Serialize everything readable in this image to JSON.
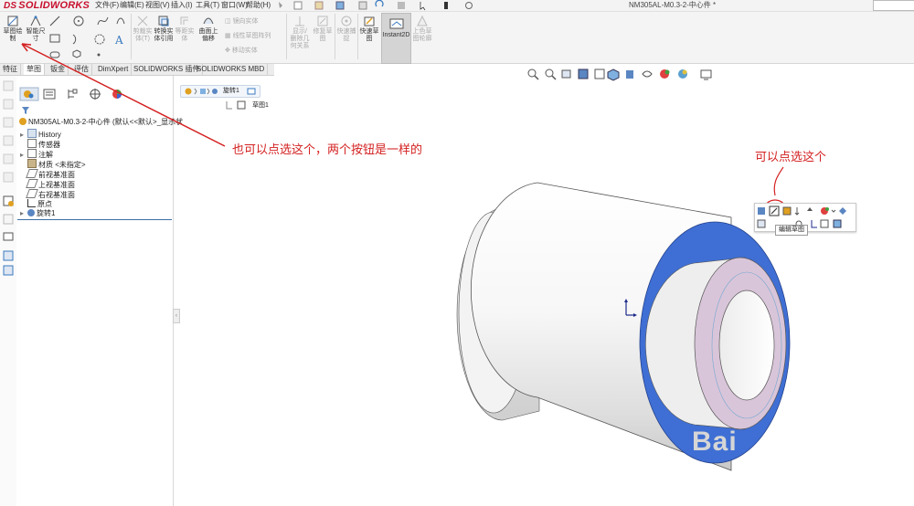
{
  "app": {
    "logo_ds": "DS",
    "logo_text": "SOLIDWORKS",
    "document_title": "NM305AL-M0.3-2-中心件 *",
    "search_placeholder": ""
  },
  "menu": [
    "文件(F)",
    "编辑(E)",
    "视图(V)",
    "插入(I)",
    "工具(T)",
    "窗口(W)",
    "帮助(H)"
  ],
  "ribbon": {
    "sketch_label_1": "草图绘",
    "sketch_label_2": "制",
    "smart_dim_1": "智能尺",
    "smart_dim_2": "寸",
    "trim_1": "剪裁实",
    "trim_2": "体(T)",
    "convert_1": "转换实",
    "convert_2": "体引用",
    "offset_1": "等距实",
    "offset_2": "体",
    "surface_offset_1": "曲面上",
    "surface_offset_2": "偏移",
    "mirror": "镜向实体",
    "linear_pattern": "线性草图阵列",
    "move": "移动实体",
    "display_delete_1": "显示/",
    "display_delete_2": "删除几",
    "display_delete_3": "何关系",
    "repair_1": "修复草",
    "repair_2": "图",
    "quick_snap_1": "快速捕",
    "quick_snap_2": "捉",
    "rapid_sketch_1": "快速草",
    "rapid_sketch_2": "图",
    "instant2d": "Instant2D",
    "shaded_1": "上色草",
    "shaded_2": "图轮廓"
  },
  "tabs": [
    {
      "label": "特征",
      "active": false
    },
    {
      "label": "草图",
      "active": true
    },
    {
      "label": "钣金",
      "active": false
    },
    {
      "label": "评估",
      "active": false
    },
    {
      "label": "DimXpert",
      "active": false
    },
    {
      "label": "SOLIDWORKS 插件",
      "active": false
    },
    {
      "label": "SOLIDWORKS MBD",
      "active": false
    }
  ],
  "tree": {
    "root": "NM305AL-M0.3-2-中心件 (默认<<默认>_显示状",
    "items": [
      {
        "label": "History",
        "expander": "▸"
      },
      {
        "label": "传感器",
        "expander": ""
      },
      {
        "label": "注解",
        "expander": "▸"
      },
      {
        "label": "材质 <未指定>",
        "expander": ""
      },
      {
        "label": "前视基准面",
        "expander": ""
      },
      {
        "label": "上视基准面",
        "expander": ""
      },
      {
        "label": "右视基准面",
        "expander": ""
      },
      {
        "label": "原点",
        "expander": ""
      },
      {
        "label": "旋转1",
        "expander": "▸"
      }
    ]
  },
  "breadcrumb": {
    "item": "旋转1",
    "sketch": "草图1"
  },
  "annotations": {
    "left_note": "也可以点选这个，两个按钮是一样的",
    "right_note": "可以点选这个"
  },
  "tooltip": "编辑草图",
  "watermark": "Bai",
  "colors": {
    "accent_red": "#d42020",
    "face_blue": "#3f6fd4",
    "inner_purple": "#d9c5d9",
    "logo_red": "#c8102e"
  }
}
